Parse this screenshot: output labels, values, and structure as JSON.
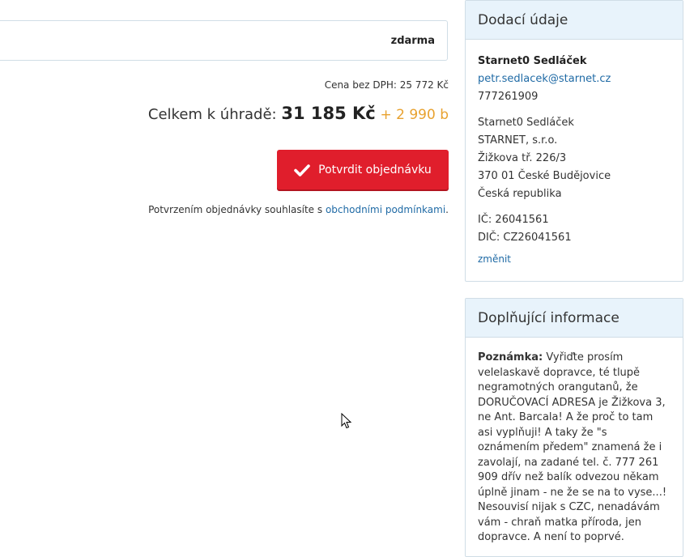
{
  "summary": {
    "shipping_price": "zdarma",
    "subtotal_label": "Cena bez DPH:",
    "subtotal_value": "25 772 Kč",
    "total_label": "Celkem k úhradě:",
    "total_value": "31 185 Kč",
    "total_points": "+ 2 990 b",
    "points_color": "#e8a230"
  },
  "confirm": {
    "button_label": "Potvrdit objednávku",
    "button_color": "#e01e2c",
    "terms_prefix": "Potvrzením objednávky souhlasíte s",
    "terms_link": "obchodními podmínkami",
    "terms_suffix": "."
  },
  "delivery": {
    "title": "Dodací údaje",
    "name": "Starnet0 Sedláček",
    "email": "petr.sedlacek@starnet.cz",
    "phone": "777261909",
    "address": [
      "Starnet0 Sedláček",
      "STARNET, s.r.o.",
      "Žižkova tř. 226/3",
      "370 01 České Budějovice",
      "Česká republika"
    ],
    "ic": "IČ: 26041561",
    "dic": "DIČ: CZ26041561",
    "change_link": "změnit"
  },
  "additional": {
    "title": "Doplňující informace",
    "note_label": "Poznámka:",
    "note_text": "Vyřiďte prosím velelaskavě dopravce, té tlupě negramotných orangutanů, že DORUČOVACÍ ADRESA je Žižkova 3, ne Ant. Barcala! A že proč to tam asi vyplňuji! A taky že \"s oznámením předem\" znamená že i zavolají, na zadané tel. č. 777 261 909 dřív než balík odvezou někam úplně jinam - ne že se na to vyse...! Nesouvisí nijak s CZC, nenadávám vám - chraň matka příroda, jen dopravce. A není to poprvé."
  },
  "colors": {
    "link": "#1f6aa5",
    "panel_header_bg": "#e8f3fb",
    "border": "#d0dde6"
  }
}
